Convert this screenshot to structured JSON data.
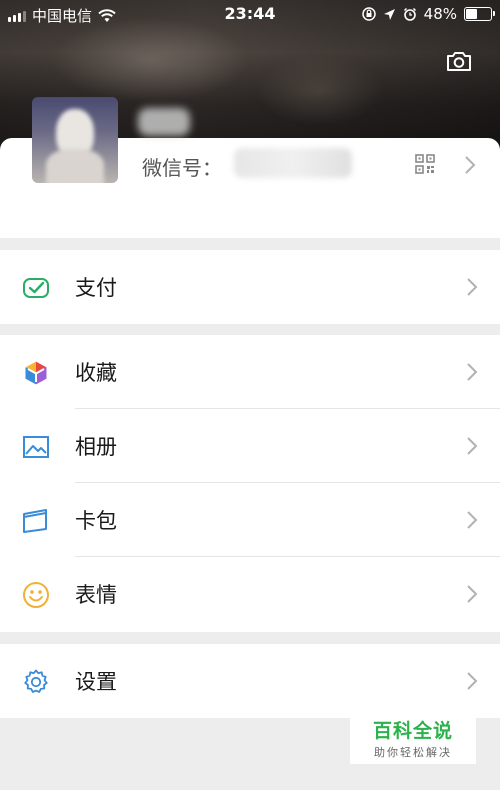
{
  "status_bar": {
    "carrier": "中国电信",
    "time": "23:44",
    "battery_percent": "48%",
    "battery_level": 0.48,
    "icons": [
      "signal-icon",
      "wifi-icon",
      "orientation-lock-icon",
      "location-icon",
      "alarm-icon",
      "battery-icon"
    ]
  },
  "header": {
    "camera_icon": "camera-icon"
  },
  "profile": {
    "wechat_id_label": "微信号：",
    "qr_icon": "qr-code-icon"
  },
  "menu": {
    "pay": {
      "label": "支付",
      "icon": "wallet-check-icon",
      "color": "#2aae67"
    },
    "favorites": {
      "label": "收藏",
      "icon": "cube-icon",
      "color": "#e9483f"
    },
    "album": {
      "label": "相册",
      "icon": "image-icon",
      "color": "#3a8bd8"
    },
    "cards": {
      "label": "卡包",
      "icon": "card-icon",
      "color": "#3a8bd8"
    },
    "stickers": {
      "label": "表情",
      "icon": "smiley-icon",
      "color": "#f2b134"
    },
    "settings": {
      "label": "设置",
      "icon": "gear-icon",
      "color": "#3a8bd8"
    }
  },
  "watermark": {
    "title": "百科全说",
    "subtitle": "助你轻松解决",
    "color": "#2bb24c"
  }
}
